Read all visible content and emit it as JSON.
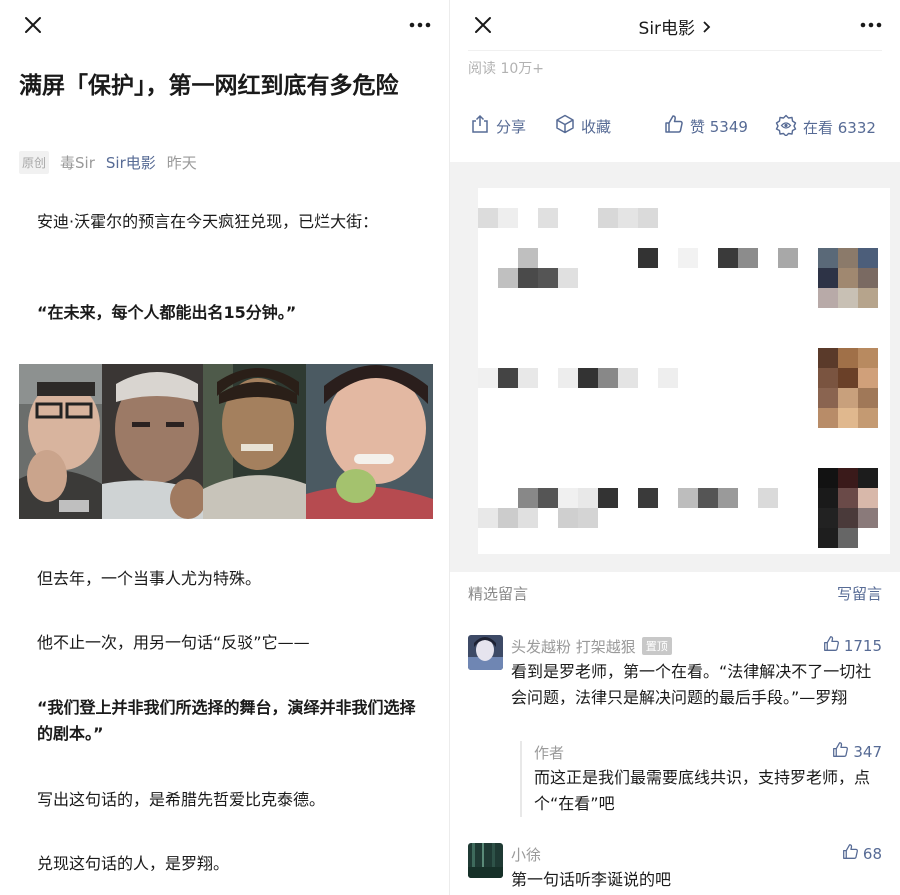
{
  "left": {
    "title": "满屏「保护」，第一网红到底有多危险",
    "meta": {
      "original_badge": "原创",
      "author": "毒Sir",
      "account": "Sir电影",
      "time": "昨天"
    },
    "paragraphs": [
      "安迪·沃霍尔的预言在今天疯狂兑现，已烂大街：",
      "“在未来，每个人都能出名15分钟。”",
      "但去年，一个当事人尤为特殊。",
      "他不止一次，用另一句话“反驳”它——",
      "“我们登上并非我们所选择的舞台，演绎并非我们选择的剧本。”",
      "写出这句话的，是希腊先哲爱比克泰德。",
      "兑现这句话的人，是罗翔。"
    ]
  },
  "right": {
    "account_title": "Sir电影",
    "read_count": "阅读 10万+",
    "actions": {
      "share": "分享",
      "favorite": "收藏",
      "like": "赞 5349",
      "watching": "在看 6332"
    },
    "comments_label": "精选留言",
    "write_comment": "写留言",
    "comments": [
      {
        "name": "头发越粉 打架越狠",
        "badge": "置顶",
        "likes": "1715",
        "text": "看到是罗老师，第一个在看。“法律解决不了一切社会问题，法律只是解决问题的最后手段。”—罗翔",
        "reply": {
          "name": "作者",
          "likes": "347",
          "text": "而这正是我们最需要底线共识，支持罗老师，点个“在看”吧"
        }
      },
      {
        "name": "小徐",
        "likes": "68",
        "text": "第一句话听李诞说的吧"
      }
    ]
  },
  "colors": {
    "link": "#576b95",
    "muted": "#9a9a9a",
    "gray_bg": "#f2f2f2"
  },
  "icons": [
    "close-icon",
    "more-icon",
    "chevron-right-icon",
    "share-icon",
    "favorite-icon",
    "thumbs-up-icon",
    "watching-icon"
  ]
}
